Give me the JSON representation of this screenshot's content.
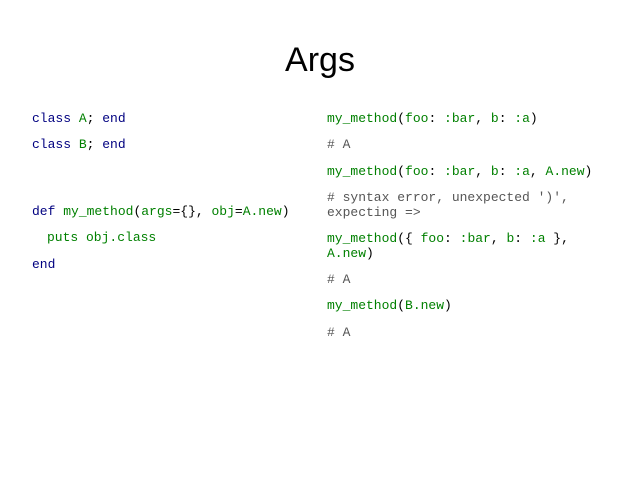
{
  "slide": {
    "title": "Args"
  },
  "left_code": {
    "line1": {
      "kw_class": "class",
      "name": "A",
      "sep": "; ",
      "kw_end": "end"
    },
    "line2": {
      "kw_class": "class",
      "name": "B",
      "sep": "; ",
      "kw_end": "end"
    },
    "line3": {
      "kw_def": "def",
      "fn": "my_method",
      "open": "(",
      "arg1": "args",
      "eq1": "={}, ",
      "arg2": "obj",
      "eq2": "=",
      "default_obj": "A.new",
      "close": ")"
    },
    "line4": {
      "body": "puts obj.class"
    },
    "line5": {
      "kw_end": "end"
    }
  },
  "right_code": {
    "call1": {
      "fn": "my_method",
      "open": "(",
      "k1": "foo",
      "c1": ": ",
      "v1": ":bar",
      "sep1": ", ",
      "k2": "b",
      "c2": ": ",
      "v2": ":a",
      "close": ")"
    },
    "result1": "# A",
    "call2": {
      "fn": "my_method",
      "open": "(",
      "k1": "foo",
      "c1": ": ",
      "v1": ":bar",
      "sep1": ", ",
      "k2": "b",
      "c2": ": ",
      "v2": ":a",
      "sep2": ", ",
      "obj": "A.new",
      "close": ")"
    },
    "result2_line1": "# syntax error, unexpected ')',",
    "result2_line2": "expecting =>",
    "call3": {
      "fn": "my_method",
      "open": "({ ",
      "k1": "foo",
      "c1": ": ",
      "v1": ":bar",
      "sep1": ", ",
      "k2": "b",
      "c2": ": ",
      "v2": ":a",
      "close_hash": " },",
      "obj": "A.new",
      "close": ")"
    },
    "result3": "# A",
    "call4": {
      "fn": "my_method",
      "open": "(",
      "obj": "B.new",
      "close": ")"
    },
    "result4": "# A"
  },
  "colors": {
    "keyword": "#000080",
    "identifier": "#008000",
    "comment": "#555555",
    "text": "#000000",
    "background": "#ffffff"
  }
}
